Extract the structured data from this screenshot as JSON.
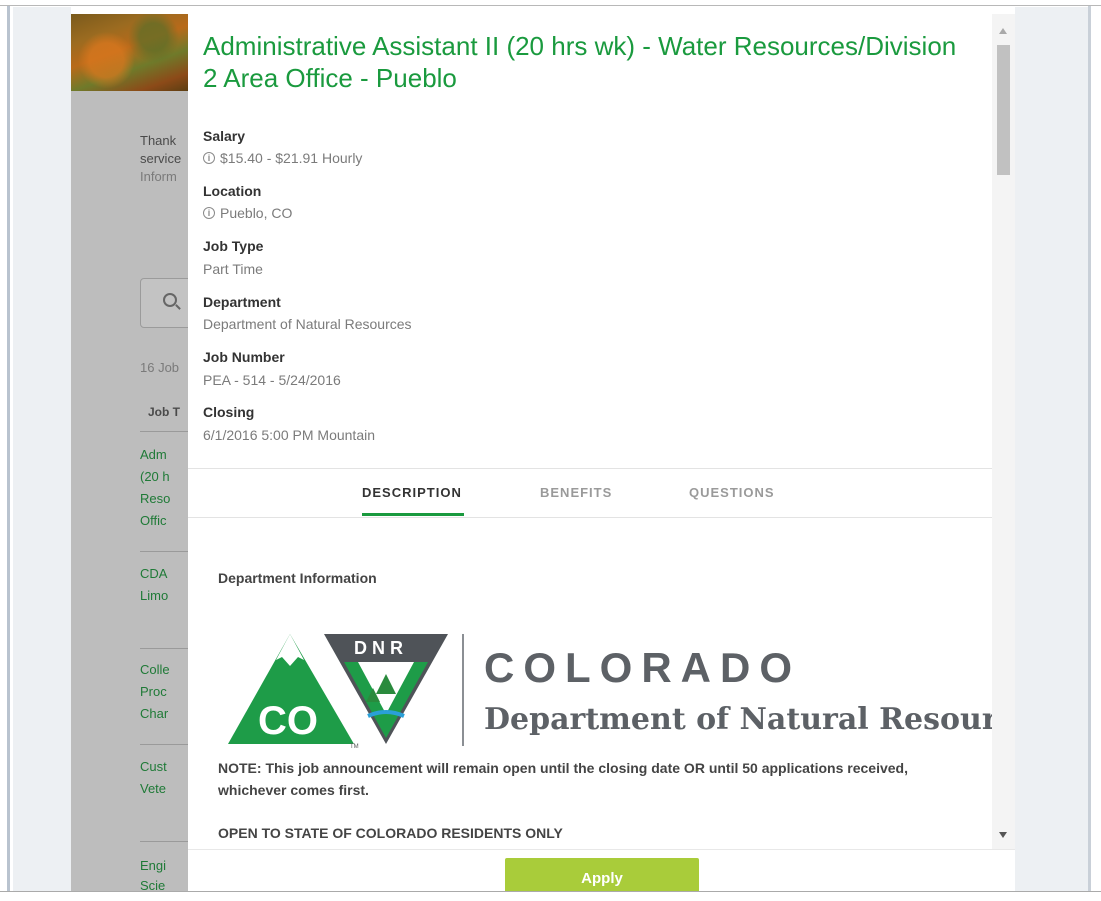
{
  "background": {
    "intro_lines": [
      "Thank",
      "service",
      "Inform"
    ],
    "job_count": "16 Job",
    "column_header": "Job T",
    "list_items": [
      [
        "Adm",
        "(20 h",
        "Reso",
        "Offic"
      ],
      [
        "CDA",
        "Limo"
      ],
      [
        "Colle",
        "Proc",
        "Char"
      ],
      [
        "Cust",
        "Vete"
      ],
      [
        "Engi",
        "Scie"
      ]
    ]
  },
  "job": {
    "title": "Administrative Assistant II (20 hrs wk) - Water Resources/Division 2 Area Office - Pueblo",
    "fields": [
      {
        "label": "Salary",
        "value": "$15.40 - $21.91 Hourly",
        "icon": "info-icon"
      },
      {
        "label": "Location",
        "value": "Pueblo, CO",
        "icon": "info-icon"
      },
      {
        "label": "Job Type",
        "value": "Part Time"
      },
      {
        "label": "Department",
        "value": "Department of Natural Resources"
      },
      {
        "label": "Job Number",
        "value": "PEA - 514 - 5/24/2016"
      },
      {
        "label": "Closing",
        "value": "6/1/2016 5:00 PM Mountain"
      }
    ]
  },
  "tabs": [
    "DESCRIPTION",
    "BENEFITS",
    "QUESTIONS"
  ],
  "active_tab": "DESCRIPTION",
  "content": {
    "section_title": "Department Information",
    "logo": {
      "badge_text": "DNR",
      "co_text": "CO",
      "tm": "TM",
      "colorado": "COLORADO",
      "department": "Department of Natural Resources"
    },
    "note": "NOTE:  This job announcement will remain open until the closing date OR until 50 applications received, whichever comes first.",
    "open_note": "OPEN TO STATE OF COLORADO RESIDENTS ONLY"
  },
  "footer": {
    "apply_label": "Apply"
  },
  "colors": {
    "accent_green": "#1a9a3e",
    "apply_green": "#a9cc3a",
    "logo_green": "#1e9c48",
    "logo_gray": "#5d6166"
  }
}
